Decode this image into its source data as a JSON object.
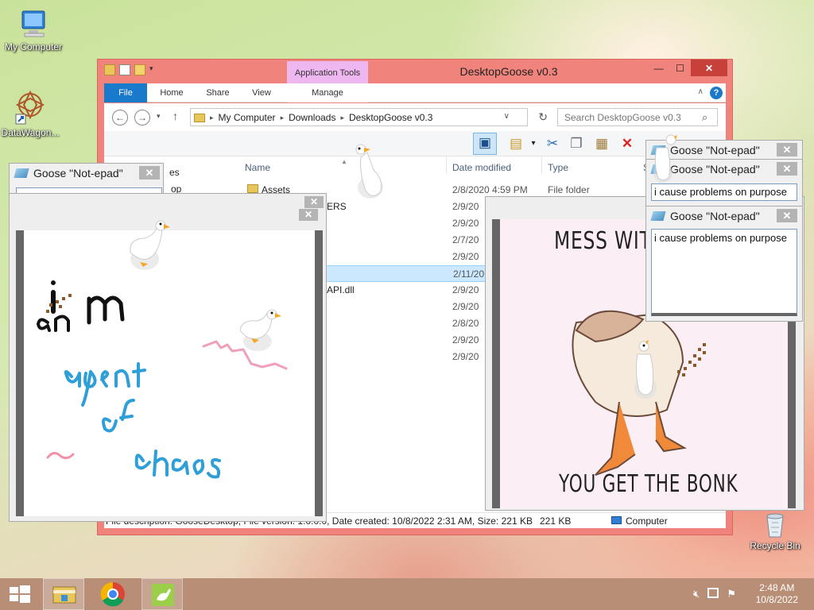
{
  "desktop": {
    "icons": [
      {
        "label": "My Computer",
        "icon": "computer-icon"
      },
      {
        "label": "DataWagon...",
        "icon": "shortcut-icon"
      },
      {
        "label": "Recycle Bin",
        "icon": "recycle-bin-icon"
      }
    ]
  },
  "explorer": {
    "title": "DesktopGoose v0.3",
    "context_tab": "Application Tools",
    "tabs": [
      "File",
      "Home",
      "Share",
      "View",
      "Manage"
    ],
    "breadcrumb": [
      "My Computer",
      "Downloads",
      "DesktopGoose v0.3"
    ],
    "search_placeholder": "Search DesktopGoose v0.3",
    "columns": [
      "Name",
      "Date modified",
      "Type"
    ],
    "columns_partial": [
      "S"
    ],
    "sidebar_partial": [
      "es",
      "op"
    ],
    "rows": [
      {
        "name": "Assets",
        "date": "2/8/2020 4:59 PM",
        "type": "File folder",
        "selected": false
      },
      {
        "name": "ERS",
        "date": "2/9/20",
        "type": "",
        "selected": false
      },
      {
        "name": "",
        "date": "2/9/20",
        "type": "",
        "selected": false
      },
      {
        "name": "",
        "date": "2/7/20",
        "type": "",
        "selected": false
      },
      {
        "name": "",
        "date": "2/9/20",
        "type": "",
        "selected": false
      },
      {
        "name": "",
        "date": "2/11/20",
        "type": "",
        "selected": true
      },
      {
        "name": "API.dll",
        "date": "2/9/20",
        "type": "",
        "selected": false
      },
      {
        "name": "",
        "date": "2/9/20",
        "type": "",
        "selected": false
      },
      {
        "name": "",
        "date": "2/8/20",
        "type": "",
        "selected": false
      },
      {
        "name": "",
        "date": "2/9/20",
        "type": "",
        "selected": false
      },
      {
        "name": "",
        "date": "2/9/20",
        "type": "",
        "selected": false
      }
    ],
    "status_text": "File description: GooseDesktop, File version: 1.0.0.0, Date created: 10/8/2022 2:31 AM, Size: 221 KB",
    "status_size": "221 KB",
    "status_location": "Computer"
  },
  "notepads": {
    "left_title": "Goose \"Not-epad\"",
    "right_titles": [
      "Goose \"Not-epad\"",
      "Goose \"Not-epad\"",
      "Goose \"Not-epad\""
    ],
    "text_peek": "i cause problems on purpose",
    "text_full": "i cause problems on purpose"
  },
  "drawing": {
    "words": [
      "i",
      "m",
      "an",
      "agent",
      "of",
      "chaos"
    ]
  },
  "meme": {
    "top_text": "MESS WITH",
    "bottom_text": "YOU GET THE BONK"
  },
  "taskbar": {
    "time": "2:48 AM",
    "date": "10/8/2022",
    "apps": [
      "start-button",
      "file-explorer",
      "chrome",
      "desktop-goose"
    ]
  },
  "colors": {
    "accent": "#1979ca",
    "explorer_frame": "#f0837b",
    "taskbar": "#b98e77",
    "context_tab": "#efb7f0"
  }
}
